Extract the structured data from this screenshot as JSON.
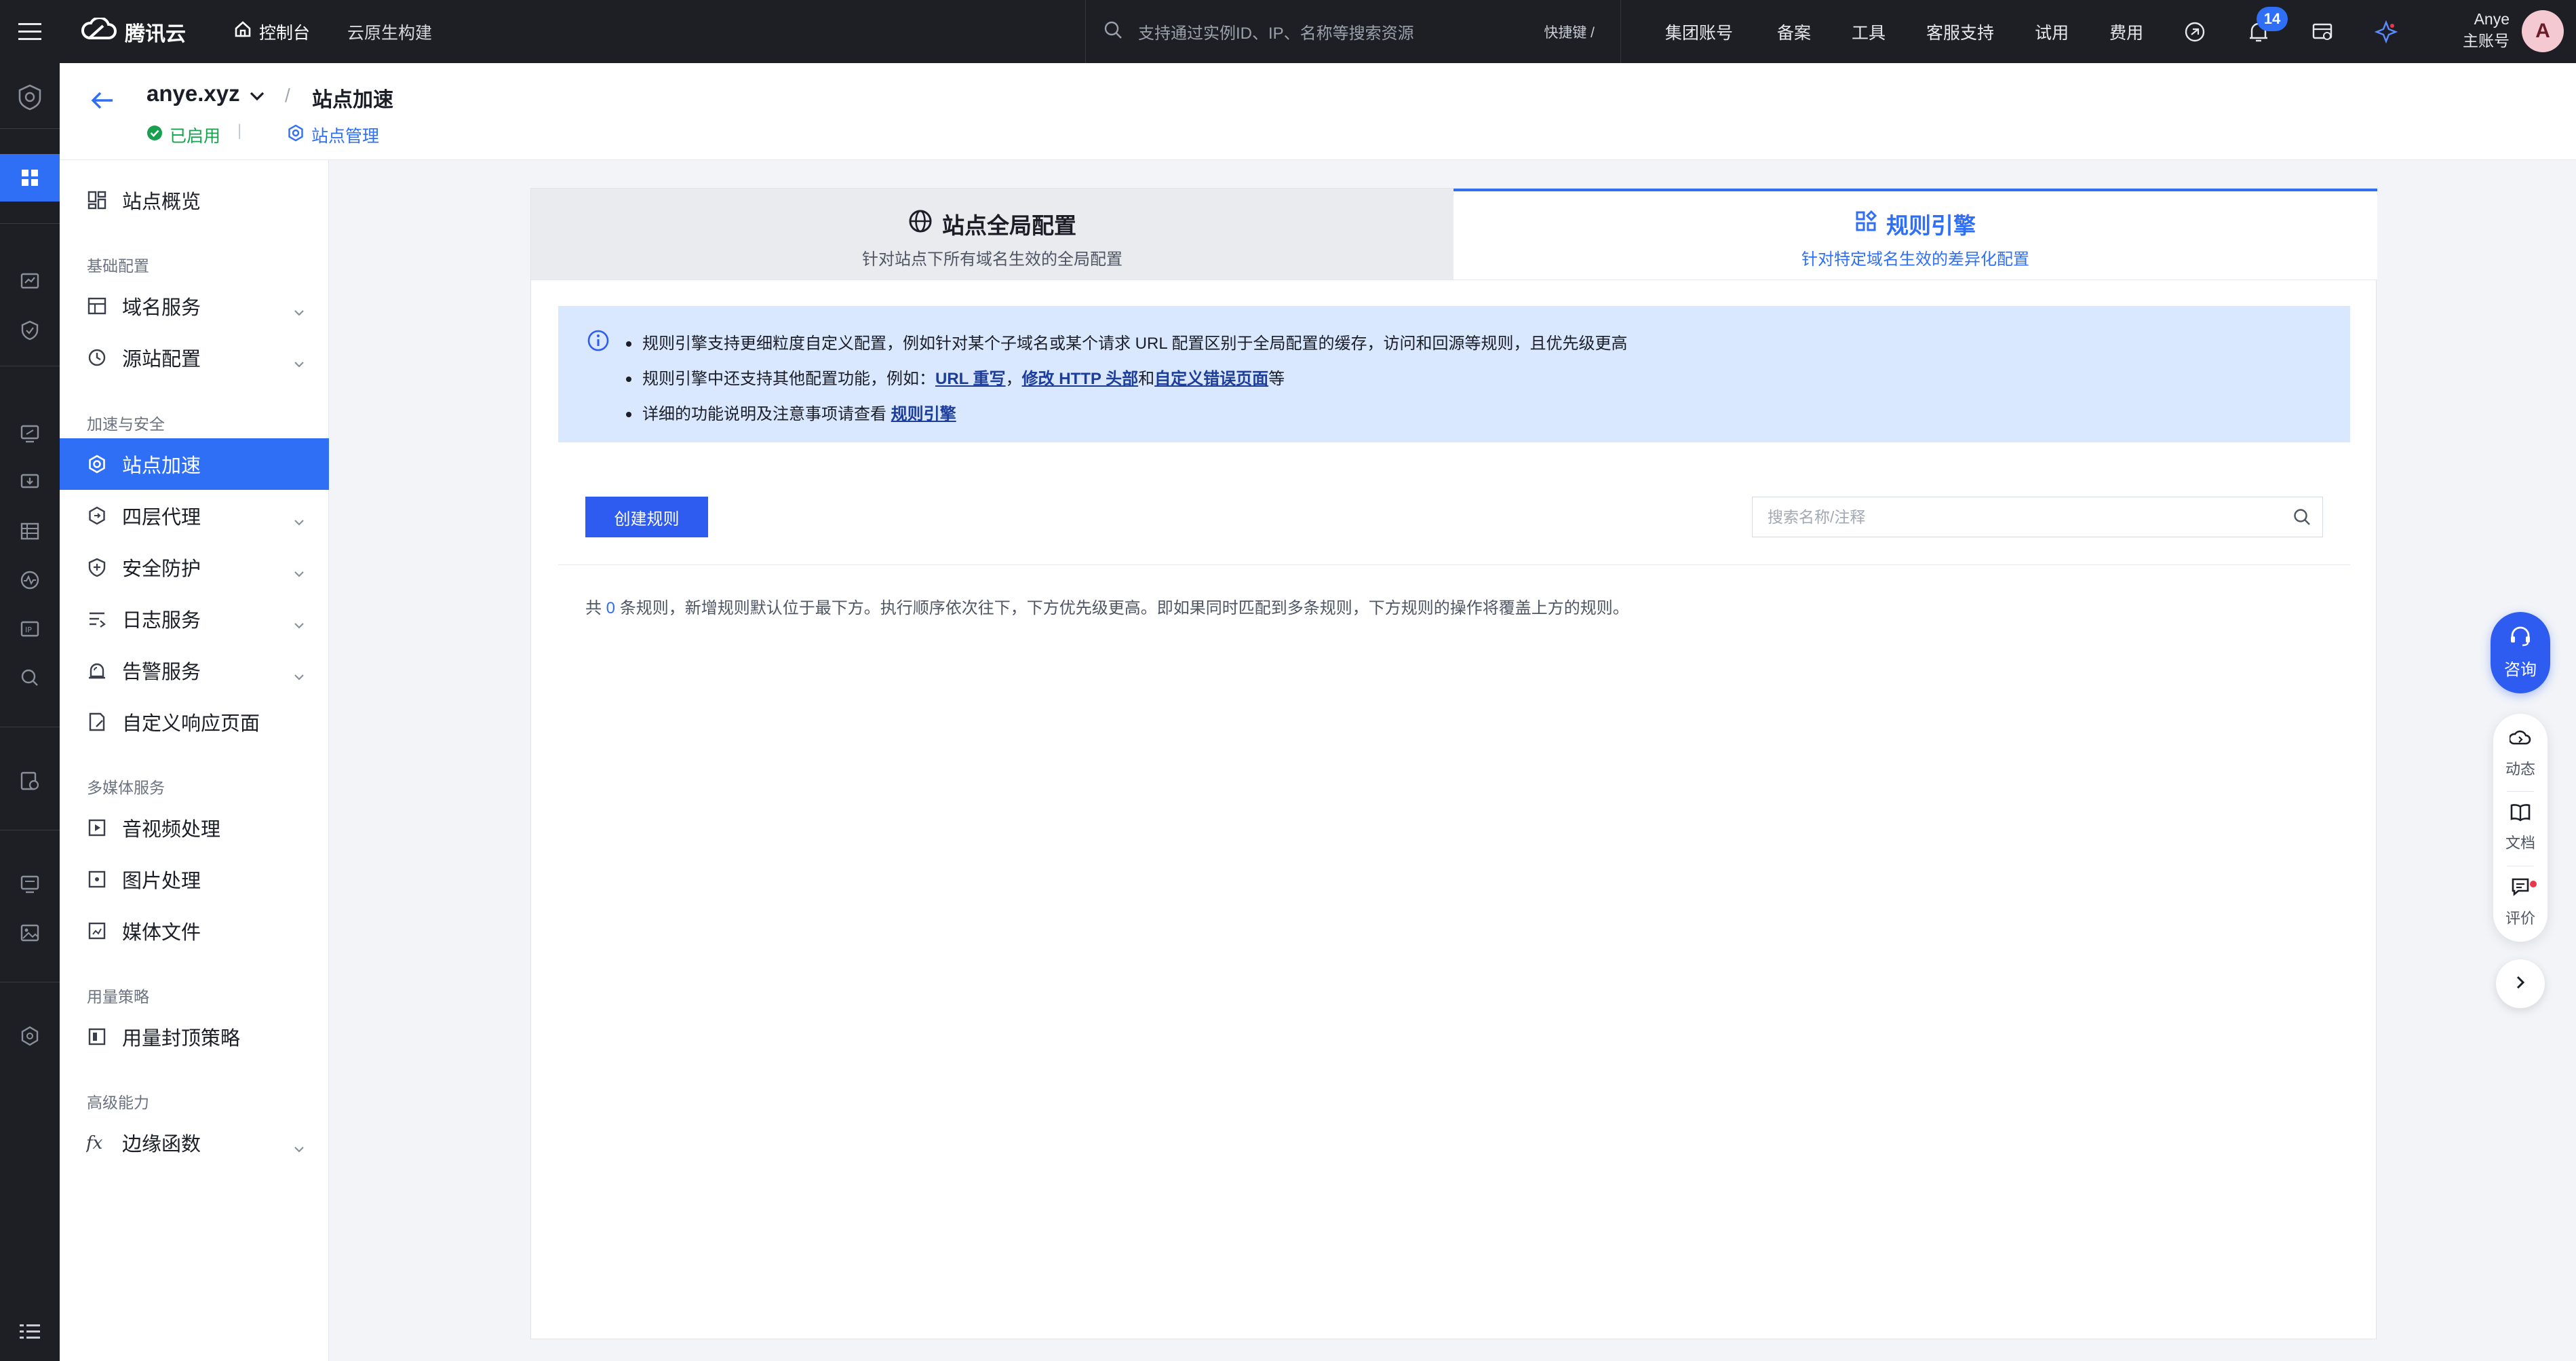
{
  "topbar": {
    "brand": "腾讯云",
    "console": "控制台",
    "cloud_native": "云原生构建",
    "search_placeholder": "支持通过实例ID、IP、名称等搜索资源",
    "shortcut": "快捷键 /",
    "nav": [
      "集团账号",
      "备案",
      "工具",
      "客服支持",
      "试用",
      "费用"
    ],
    "notification_count": "14",
    "user_name": "Anye",
    "user_role": "主账号",
    "avatar_letter": "A"
  },
  "header": {
    "site_name": "anye.xyz",
    "crumb_sep": "/",
    "current_page": "站点加速",
    "status": "已启用",
    "status_sep": "|",
    "site_management": "站点管理"
  },
  "sidebar": {
    "overview": "站点概览",
    "group_basic": "基础配置",
    "domain_service": "域名服务",
    "origin_config": "源站配置",
    "group_accel": "加速与安全",
    "site_accel": "站点加速",
    "l4_proxy": "四层代理",
    "security": "安全防护",
    "log_service": "日志服务",
    "alarm_service": "告警服务",
    "custom_response": "自定义响应页面",
    "group_media": "多媒体服务",
    "av_processing": "音视频处理",
    "image_processing": "图片处理",
    "media_files": "媒体文件",
    "group_usage": "用量策略",
    "usage_cap": "用量封顶策略",
    "group_advanced": "高级能力",
    "edge_functions": "边缘函数"
  },
  "tabs": {
    "global": {
      "title": "站点全局配置",
      "subtitle": "针对站点下所有域名生效的全局配置"
    },
    "rules": {
      "title": "规则引擎",
      "subtitle": "针对特定域名生效的差异化配置"
    }
  },
  "notice": {
    "line1": "规则引擎支持更细粒度自定义配置，例如针对某个子域名或某个请求 URL 配置区别于全局配置的缓存，访问和回源等规则，且优先级更高",
    "line2_prefix": "规则引擎中还支持其他配置功能，例如：",
    "link_url_rewrite": "URL 重写",
    "sep1": "，",
    "link_http_header": "修改 HTTP 头部",
    "and": "和",
    "link_custom_error": "自定义错误页面",
    "line2_suffix": "等",
    "line3_prefix": "详细的功能说明及注意事项请查看 ",
    "link_rule_engine": "规则引擎"
  },
  "actions": {
    "create_rule": "创建规则",
    "search_placeholder": "搜索名称/注释"
  },
  "summary": {
    "prefix": "共 ",
    "count": "0",
    "suffix": " 条规则，新增规则默认位于最下方。执行顺序依次往下，下方优先级更高。即如果同时匹配到多条规则，下方规则的操作将覆盖上方的规则。"
  },
  "float": {
    "consult": "咨询",
    "news": "动态",
    "docs": "文档",
    "feedback": "评价"
  },
  "colors": {
    "accent": "#2f6ff6",
    "topbar_bg": "#1d1f24",
    "notice_bg": "#d9e7ff",
    "success": "#17a14f"
  }
}
